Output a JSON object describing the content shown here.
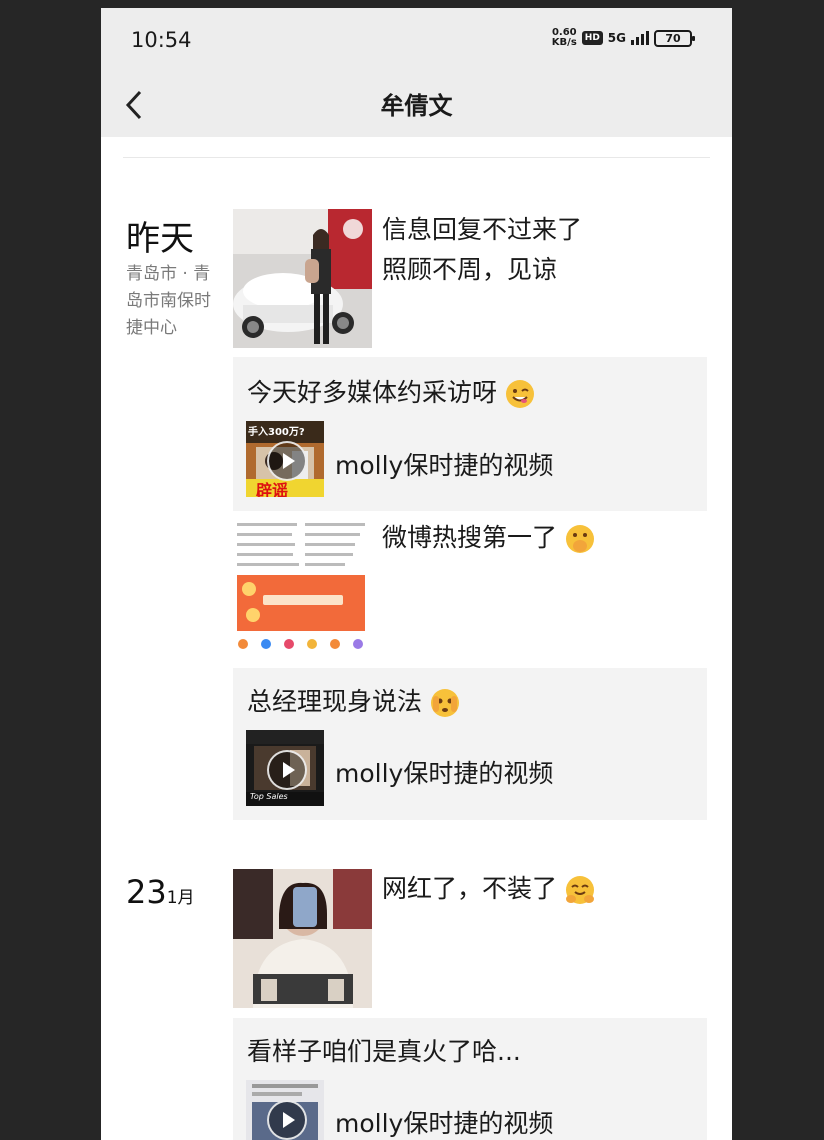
{
  "status": {
    "time": "10:54",
    "net_speed_top": "0.60",
    "net_speed_bottom": "KB/s",
    "hd": "HD",
    "network": "5G",
    "battery": "70"
  },
  "header": {
    "title": "牟倩文"
  },
  "entries": [
    {
      "date": "昨天",
      "location": "青岛市 · 青岛市南保时捷中心",
      "post_text_line1": "信息回复不过来了",
      "post_text_line2": "照顾不周，见谅"
    }
  ],
  "shares": [
    {
      "title": "今天好多媒体约采访呀",
      "thumb_caption_top": "手入300万?",
      "thumb_caption_bottom": "辟谣",
      "label": "molly保时捷的视频"
    },
    {
      "title": "总经理现身说法",
      "thumb_caption_bottom": "Top Sales",
      "label": "molly保时捷的视频"
    },
    {
      "title": "看样子咱们是真火了哈...",
      "label": "molly保时捷的视频"
    }
  ],
  "weibo_post": {
    "text": "微博热搜第一了"
  },
  "entry2": {
    "day": "23",
    "month": "1月",
    "post_text": "网红了，不装了"
  },
  "icons": {
    "back": "chevron-left-icon",
    "play": "play-icon"
  }
}
